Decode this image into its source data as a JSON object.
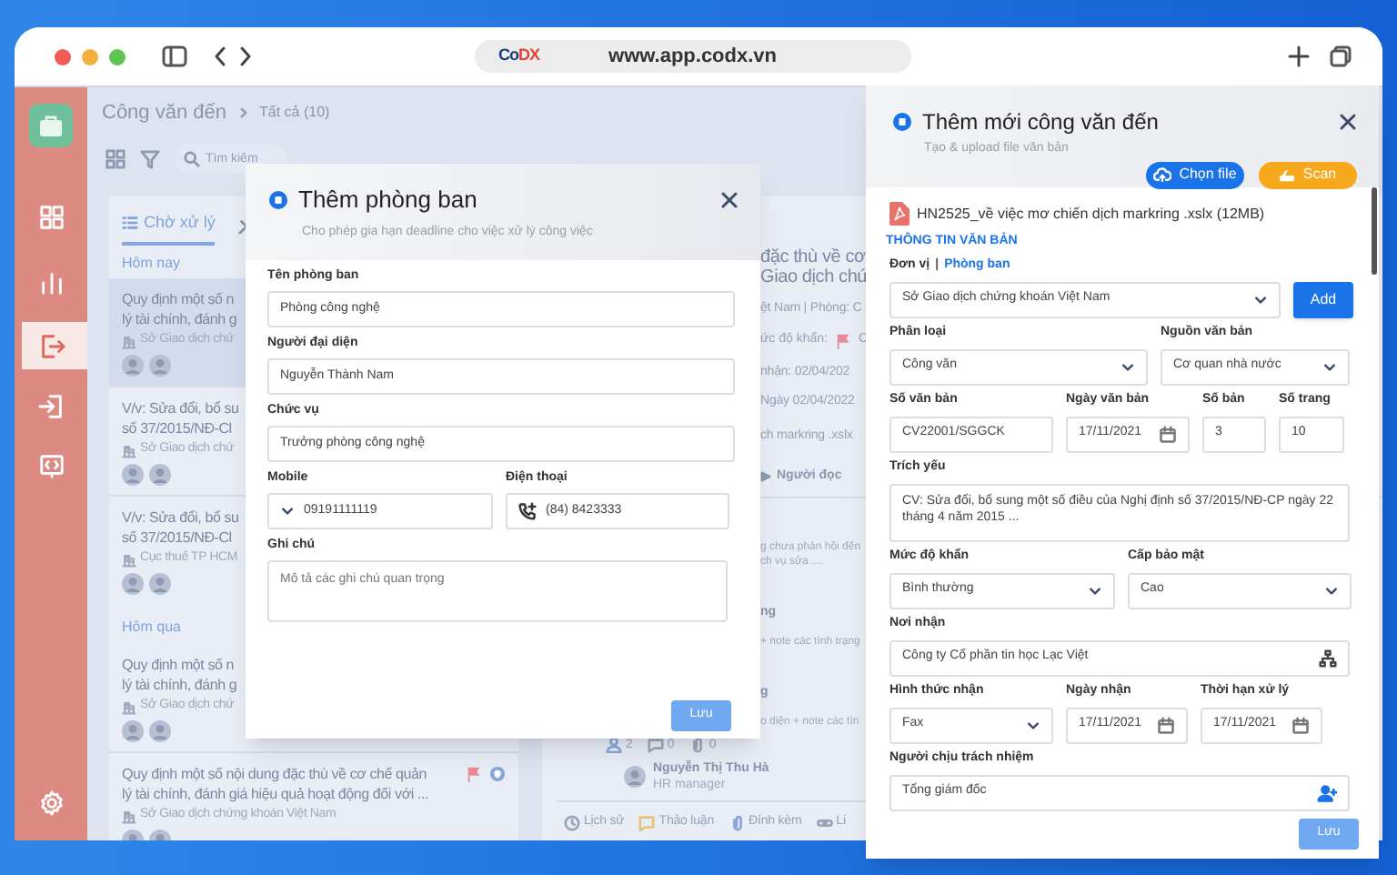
{
  "browser": {
    "logo": "CoDX",
    "url": "www.app.codx.vn"
  },
  "rail": [
    {
      "kind": "apps",
      "selected": false
    },
    {
      "kind": "chart",
      "selected": false
    },
    {
      "kind": "outbox",
      "selected": true
    },
    {
      "kind": "inbox",
      "selected": false
    },
    {
      "kind": "code",
      "selected": false
    },
    {
      "kind": "settings",
      "selected": false
    }
  ],
  "header": {
    "title": "Công văn đến",
    "breadcrumb": "Tất cả (10)",
    "search_placeholder": "Tìm kiếm"
  },
  "list": {
    "tabs": [
      {
        "kind": "list",
        "label": "Chờ xử lý",
        "selected": true
      },
      {
        "kind": "tools",
        "selected": false
      }
    ],
    "groups": [
      {
        "label": "Hôm nay",
        "items": [
          {
            "lines": [
              "Quy định một số n",
              "lý tài chính, đánh g"
            ],
            "org": "Sở Giao dịch chứ",
            "selected": true
          },
          {
            "lines": [
              "V/v: Sửa đổi, bổ su",
              "số 37/2015/NĐ-Cl"
            ],
            "org": "Sở Giao dịch chứ",
            "selected": false
          },
          {
            "lines": [
              "V/v: Sửa đổi, bổ su",
              "số 37/2015/NĐ-Cl"
            ],
            "org": "Cục thuế TP HCM",
            "selected": false
          }
        ]
      },
      {
        "label": "Hôm qua",
        "items": [
          {
            "lines": [
              "Quy định một số n",
              "lý tài chính, đánh g"
            ],
            "org": "Sở Giao dịch chứ",
            "selected": false
          },
          {
            "lines": [
              "Quy định một số nội dung đặc thù về cơ chế quản",
              "lý tài chính, đánh giá hiệu quả hoạt động đối với ..."
            ],
            "org": "Sở Giao dịch chứng khoán Việt Nam",
            "selected": false,
            "flagged": true
          }
        ]
      }
    ]
  },
  "detail": {
    "title_lines": [
      "đặc thù về cơ",
      "Giao dịch chứ"
    ],
    "org_line": "ệt Nam | Phòng: C",
    "urgency": {
      "label": "ức độ khẩn:",
      "value": "C"
    },
    "received": "nhận: 02/04/202",
    "date": "Ngày 02/04/2022",
    "file": "ch markring .xslx",
    "readers": "Người đọc",
    "activity": [
      {
        "kind": "note",
        "text": "g chưa phản hồi đến"
      },
      {
        "kind": "note",
        "text": "ch vụ sửa ...."
      },
      {
        "kind": "title",
        "text": "ng"
      },
      {
        "kind": "note",
        "text": "+ note các tình trạng"
      },
      {
        "kind": "title",
        "text": "g"
      },
      {
        "kind": "note",
        "text": "o diện + note các tìn"
      }
    ],
    "counts": [
      {
        "kind": "assignees",
        "value": "2"
      },
      {
        "kind": "comments",
        "value": "0"
      },
      {
        "kind": "attachments",
        "value": "0"
      }
    ],
    "person": {
      "name": "Nguyễn Thị Thu Hà",
      "role": "HR manager"
    },
    "tabs": [
      {
        "kind": "history",
        "label": "Lịch sử"
      },
      {
        "kind": "chat",
        "label": "Thảo luận"
      },
      {
        "kind": "attach",
        "label": "Đính kèm"
      },
      {
        "kind": "link",
        "label": "Li"
      }
    ]
  },
  "dialog": {
    "title": "Thêm phòng ban",
    "subtitle": "Cho phép gia hạn deadline cho việc xử lý công việc",
    "rows": [
      [
        {
          "kind": "text",
          "label": "Tên phòng ban",
          "value": "Phòng công nghệ"
        }
      ],
      [
        {
          "kind": "text",
          "label": "Người đại diện",
          "value": "Nguyễn Thành Nam"
        }
      ],
      [
        {
          "kind": "text",
          "label": "Chức vụ",
          "value": "Trưởng phòng công nghệ"
        }
      ],
      [
        {
          "kind": "mobile",
          "label": "Mobile",
          "value": "09191111119"
        },
        {
          "kind": "phone",
          "label": "Điện thoại",
          "value": "(84) 8423333"
        }
      ],
      [
        {
          "kind": "textarea",
          "label": "Ghi chú",
          "placeholder": "Mô tả các ghi chú quan trọng"
        }
      ]
    ],
    "save": "Lưu"
  },
  "panel": {
    "title": "Thêm mới công văn đến",
    "subtitle": "Tạo & upload file văn bản",
    "actions": [
      {
        "kind": "upload",
        "label": "Chọn file"
      },
      {
        "kind": "scan",
        "label": "Scan"
      }
    ],
    "file": "HN2525_về việc mơ chiến dịch markring .xslx (12MB)",
    "section": "THÔNG TIN VĂN BẢN",
    "unit": {
      "kind": "select",
      "label": "Đơn vị",
      "separator": "|",
      "label_link": "Phòng ban",
      "value": "Sở Giao dịch chứng khoán Việt Nam",
      "button": "Add"
    },
    "rows": [
      [
        {
          "kind": "select",
          "label": "Phân loại",
          "value": "Công văn"
        },
        {
          "kind": "select",
          "label": "Nguồn văn bản",
          "value": "Cơ quan nhà nước"
        }
      ],
      [
        {
          "kind": "text",
          "label": "Số văn bản",
          "value": "CV22001/SGGCK"
        },
        {
          "kind": "date",
          "label": "Ngày văn bản",
          "value": "17/11/2021"
        },
        {
          "kind": "text",
          "label": "Số bản",
          "value": "3"
        },
        {
          "kind": "text",
          "label": "Số trang",
          "value": "10"
        }
      ],
      [
        {
          "kind": "textarea",
          "label": "Trích yếu",
          "value": "CV: Sửa đổi, bổ sung một số điều của Nghị định số 37/2015/NĐ-CP ngày 22 tháng 4 năm 2015 ..."
        }
      ],
      [
        {
          "kind": "select",
          "label": "Mức độ khẩn",
          "value": "Bình thường"
        },
        {
          "kind": "select",
          "label": "Cấp bảo mật",
          "value": "Cao"
        }
      ],
      [
        {
          "kind": "org",
          "label": "Nơi nhận",
          "value": "Công ty Cổ phần tin học Lạc Việt"
        }
      ],
      [
        {
          "kind": "select",
          "label": "Hình thức nhận",
          "value": "Fax"
        },
        {
          "kind": "date",
          "label": "Ngày nhận",
          "value": "17/11/2021"
        },
        {
          "kind": "date",
          "label": "Thời hạn xử lý",
          "value": "17/11/2021"
        }
      ],
      [
        {
          "kind": "person",
          "label": "Người chịu trách nhiệm",
          "value": "Tổng giám đốc"
        }
      ]
    ],
    "save": "Lưu"
  }
}
